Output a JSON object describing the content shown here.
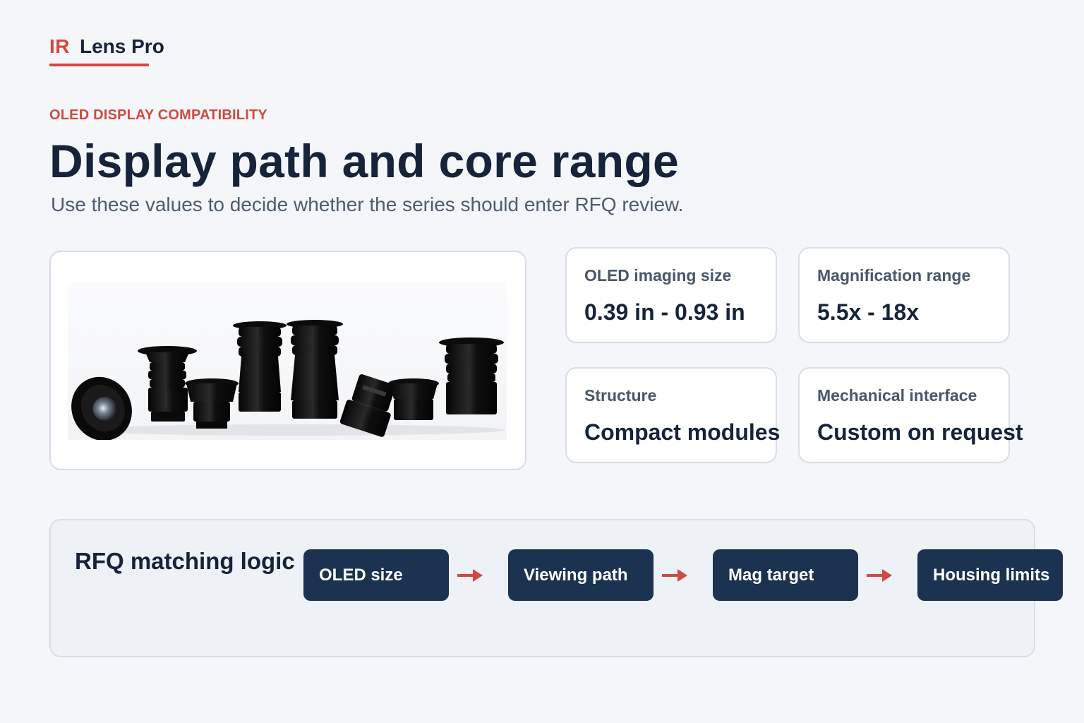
{
  "brand": {
    "prefix": "IR",
    "name": "Lens Pro",
    "accent_color": "#d04a3f"
  },
  "eyebrow": "OLED DISPLAY COMPATIBILITY",
  "headline": "Display path and core range",
  "subheadline": "Use these values to decide whether the series should enter RFQ review.",
  "specs": [
    {
      "label": "OLED imaging size",
      "value": "0.39 in - 0.93 in"
    },
    {
      "label": "Magnification range",
      "value": "5.5x - 18x"
    },
    {
      "label": "Structure",
      "value": "Compact modules"
    },
    {
      "label": "Mechanical interface",
      "value": "Custom on request"
    }
  ],
  "flow": {
    "title": "RFQ matching logic",
    "steps": [
      "OLED size",
      "Viewing path",
      "Mag target",
      "Housing limits"
    ],
    "step_color": "#1b3250",
    "arrow_color": "#d04a3f"
  }
}
